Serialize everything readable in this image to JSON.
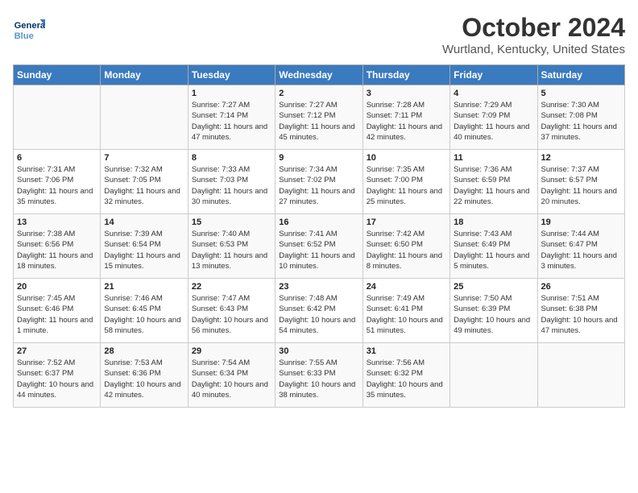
{
  "header": {
    "logo_line1": "General",
    "logo_line2": "Blue",
    "title": "October 2024",
    "subtitle": "Wurtland, Kentucky, United States"
  },
  "days_of_week": [
    "Sunday",
    "Monday",
    "Tuesday",
    "Wednesday",
    "Thursday",
    "Friday",
    "Saturday"
  ],
  "weeks": [
    [
      {
        "num": "",
        "detail": ""
      },
      {
        "num": "",
        "detail": ""
      },
      {
        "num": "1",
        "detail": "Sunrise: 7:27 AM\nSunset: 7:14 PM\nDaylight: 11 hours and 47 minutes."
      },
      {
        "num": "2",
        "detail": "Sunrise: 7:27 AM\nSunset: 7:12 PM\nDaylight: 11 hours and 45 minutes."
      },
      {
        "num": "3",
        "detail": "Sunrise: 7:28 AM\nSunset: 7:11 PM\nDaylight: 11 hours and 42 minutes."
      },
      {
        "num": "4",
        "detail": "Sunrise: 7:29 AM\nSunset: 7:09 PM\nDaylight: 11 hours and 40 minutes."
      },
      {
        "num": "5",
        "detail": "Sunrise: 7:30 AM\nSunset: 7:08 PM\nDaylight: 11 hours and 37 minutes."
      }
    ],
    [
      {
        "num": "6",
        "detail": "Sunrise: 7:31 AM\nSunset: 7:06 PM\nDaylight: 11 hours and 35 minutes."
      },
      {
        "num": "7",
        "detail": "Sunrise: 7:32 AM\nSunset: 7:05 PM\nDaylight: 11 hours and 32 minutes."
      },
      {
        "num": "8",
        "detail": "Sunrise: 7:33 AM\nSunset: 7:03 PM\nDaylight: 11 hours and 30 minutes."
      },
      {
        "num": "9",
        "detail": "Sunrise: 7:34 AM\nSunset: 7:02 PM\nDaylight: 11 hours and 27 minutes."
      },
      {
        "num": "10",
        "detail": "Sunrise: 7:35 AM\nSunset: 7:00 PM\nDaylight: 11 hours and 25 minutes."
      },
      {
        "num": "11",
        "detail": "Sunrise: 7:36 AM\nSunset: 6:59 PM\nDaylight: 11 hours and 22 minutes."
      },
      {
        "num": "12",
        "detail": "Sunrise: 7:37 AM\nSunset: 6:57 PM\nDaylight: 11 hours and 20 minutes."
      }
    ],
    [
      {
        "num": "13",
        "detail": "Sunrise: 7:38 AM\nSunset: 6:56 PM\nDaylight: 11 hours and 18 minutes."
      },
      {
        "num": "14",
        "detail": "Sunrise: 7:39 AM\nSunset: 6:54 PM\nDaylight: 11 hours and 15 minutes."
      },
      {
        "num": "15",
        "detail": "Sunrise: 7:40 AM\nSunset: 6:53 PM\nDaylight: 11 hours and 13 minutes."
      },
      {
        "num": "16",
        "detail": "Sunrise: 7:41 AM\nSunset: 6:52 PM\nDaylight: 11 hours and 10 minutes."
      },
      {
        "num": "17",
        "detail": "Sunrise: 7:42 AM\nSunset: 6:50 PM\nDaylight: 11 hours and 8 minutes."
      },
      {
        "num": "18",
        "detail": "Sunrise: 7:43 AM\nSunset: 6:49 PM\nDaylight: 11 hours and 5 minutes."
      },
      {
        "num": "19",
        "detail": "Sunrise: 7:44 AM\nSunset: 6:47 PM\nDaylight: 11 hours and 3 minutes."
      }
    ],
    [
      {
        "num": "20",
        "detail": "Sunrise: 7:45 AM\nSunset: 6:46 PM\nDaylight: 11 hours and 1 minute."
      },
      {
        "num": "21",
        "detail": "Sunrise: 7:46 AM\nSunset: 6:45 PM\nDaylight: 10 hours and 58 minutes."
      },
      {
        "num": "22",
        "detail": "Sunrise: 7:47 AM\nSunset: 6:43 PM\nDaylight: 10 hours and 56 minutes."
      },
      {
        "num": "23",
        "detail": "Sunrise: 7:48 AM\nSunset: 6:42 PM\nDaylight: 10 hours and 54 minutes."
      },
      {
        "num": "24",
        "detail": "Sunrise: 7:49 AM\nSunset: 6:41 PM\nDaylight: 10 hours and 51 minutes."
      },
      {
        "num": "25",
        "detail": "Sunrise: 7:50 AM\nSunset: 6:39 PM\nDaylight: 10 hours and 49 minutes."
      },
      {
        "num": "26",
        "detail": "Sunrise: 7:51 AM\nSunset: 6:38 PM\nDaylight: 10 hours and 47 minutes."
      }
    ],
    [
      {
        "num": "27",
        "detail": "Sunrise: 7:52 AM\nSunset: 6:37 PM\nDaylight: 10 hours and 44 minutes."
      },
      {
        "num": "28",
        "detail": "Sunrise: 7:53 AM\nSunset: 6:36 PM\nDaylight: 10 hours and 42 minutes."
      },
      {
        "num": "29",
        "detail": "Sunrise: 7:54 AM\nSunset: 6:34 PM\nDaylight: 10 hours and 40 minutes."
      },
      {
        "num": "30",
        "detail": "Sunrise: 7:55 AM\nSunset: 6:33 PM\nDaylight: 10 hours and 38 minutes."
      },
      {
        "num": "31",
        "detail": "Sunrise: 7:56 AM\nSunset: 6:32 PM\nDaylight: 10 hours and 35 minutes."
      },
      {
        "num": "",
        "detail": ""
      },
      {
        "num": "",
        "detail": ""
      }
    ]
  ]
}
